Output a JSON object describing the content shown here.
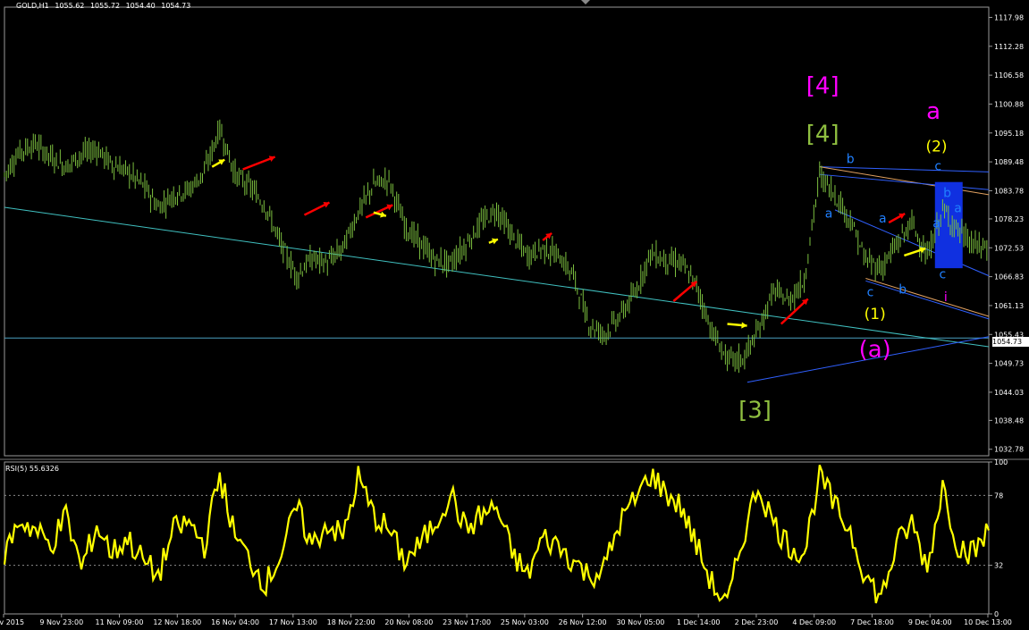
{
  "header": {
    "symbol": "GOLD,H1",
    "open": "1055.62",
    "high": "1055.72",
    "low": "1054.40",
    "close": "1054.73"
  },
  "current_price": "1054.73",
  "rsi": {
    "label": "RSI(5) 55.6326",
    "levels": [
      100,
      78,
      32,
      0
    ]
  },
  "colors": {
    "background": "#000000",
    "candles": "#7cbf3f",
    "rsi_line": "#ffff00",
    "trend_line": "#40c0c0",
    "channel": "#3060ff",
    "wave_magenta": "#ff00ff",
    "wave_green": "#8fbf40",
    "wave_yellow": "#ffff00",
    "wave_blue": "#2080ff",
    "arrow_red": "#ff0000",
    "arrow_yellow": "#ffff00"
  },
  "wave_labels": [
    {
      "text": "[4]",
      "color": "magenta",
      "time": 53.2,
      "price": 1103.0
    },
    {
      "text": "[4]",
      "color": "green",
      "time": 53.2,
      "price": 1093.5
    },
    {
      "text": "[3]",
      "color": "green",
      "time": 48.8,
      "price": 1039.0
    },
    {
      "text": "a",
      "color": "magenta",
      "time": 60.4,
      "price": 1098.0
    },
    {
      "text": "(2)",
      "color": "yellow",
      "time": 60.6,
      "price": 1091.5
    },
    {
      "text": "(1)",
      "color": "yellow",
      "time": 56.6,
      "price": 1058.5
    },
    {
      "text": "(a)",
      "color": "magenta",
      "time": 56.6,
      "price": 1051.0
    },
    {
      "text": "b",
      "color": "blue",
      "time": 55.0,
      "price": 1089.2
    },
    {
      "text": "c",
      "color": "blue",
      "time": 60.7,
      "price": 1087.8
    },
    {
      "text": "b",
      "color": "blue",
      "time": 61.3,
      "price": 1082.5
    },
    {
      "text": "a",
      "color": "blue",
      "time": 53.6,
      "price": 1078.5
    },
    {
      "text": "a",
      "color": "blue",
      "time": 57.1,
      "price": 1077.5
    },
    {
      "text": "a",
      "color": "blue",
      "time": 62.0,
      "price": 1079.5
    },
    {
      "text": "a",
      "color": "blue",
      "time": 60.6,
      "price": 1076.5
    },
    {
      "text": "c",
      "color": "blue",
      "time": 56.3,
      "price": 1063.0
    },
    {
      "text": "b",
      "color": "blue",
      "time": 58.4,
      "price": 1063.5
    },
    {
      "text": "c",
      "color": "blue",
      "time": 61.0,
      "price": 1066.5
    },
    {
      "text": "i",
      "color": "magenta",
      "time": 61.2,
      "price": 1062.0
    }
  ],
  "chart_data": [
    {
      "type": "candlestick",
      "title": "GOLD,H1 1055.62 1055.72 1054.40 1054.73",
      "x_axis_labels": [
        "6 Nov 2015",
        "9 Nov 23:00",
        "11 Nov 09:00",
        "12 Nov 18:00",
        "16 Nov 04:00",
        "17 Nov 13:00",
        "18 Nov 22:00",
        "20 Nov 08:00",
        "23 Nov 17:00",
        "25 Nov 03:00",
        "26 Nov 12:00",
        "30 Nov 05:00",
        "1 Dec 14:00",
        "2 Dec 23:00",
        "4 Dec 09:00",
        "7 Dec 18:00",
        "9 Dec 04:00",
        "10 Dec 13:00"
      ],
      "y_ticks": [
        1117.98,
        1112.28,
        1106.58,
        1100.88,
        1095.18,
        1089.48,
        1083.78,
        1078.23,
        1072.53,
        1066.83,
        1061.13,
        1055.43,
        1049.73,
        1044.03,
        1038.48,
        1032.78
      ],
      "ylim": [
        1031.5,
        1120.0
      ],
      "series": [
        {
          "name": "GOLD,H1",
          "x": [
            0,
            1,
            2,
            3,
            4,
            5,
            6,
            7,
            8,
            9,
            10,
            11,
            12,
            13,
            14,
            15,
            16,
            17,
            18,
            19,
            20,
            21,
            22,
            23,
            24,
            25,
            26,
            27,
            28,
            29,
            30,
            31,
            32,
            33,
            34,
            35,
            36,
            37,
            38,
            39,
            40,
            41,
            42,
            43,
            44,
            45,
            46,
            47,
            48,
            49,
            50,
            51,
            52,
            53,
            54,
            55,
            56,
            57,
            58,
            59,
            60,
            61,
            62,
            63,
            64
          ],
          "close": [
            1087.0,
            1091.5,
            1093.0,
            1090.5,
            1088.5,
            1091.0,
            1092.0,
            1089.0,
            1087.5,
            1085.0,
            1080.5,
            1083.0,
            1084.0,
            1087.5,
            1096.0,
            1087.0,
            1084.5,
            1080.5,
            1073.0,
            1067.0,
            1070.5,
            1069.5,
            1072.5,
            1079.5,
            1085.0,
            1086.0,
            1077.0,
            1073.5,
            1070.0,
            1069.5,
            1073.0,
            1077.5,
            1080.0,
            1075.0,
            1071.0,
            1072.5,
            1071.0,
            1067.0,
            1057.5,
            1055.5,
            1059.0,
            1063.5,
            1071.5,
            1070.0,
            1069.5,
            1065.0,
            1056.0,
            1050.5,
            1050.5,
            1056.0,
            1064.0,
            1062.0,
            1066.0,
            1087.0,
            1083.0,
            1078.0,
            1070.0,
            1068.5,
            1073.0,
            1077.5,
            1070.5,
            1080.0,
            1076.0,
            1073.0,
            1072.5
          ]
        }
      ],
      "annotations": [
        "[4]",
        "[4]",
        "[3]",
        "a",
        "(2)",
        "(1)",
        "(a)",
        "b",
        "c",
        "b",
        "a",
        "a",
        "a",
        "a",
        "c",
        "b",
        "c",
        "i"
      ]
    },
    {
      "type": "line",
      "title": "RSI(5) 55.6326",
      "y_ticks": [
        100,
        78,
        32,
        0
      ],
      "ylim": [
        0,
        100
      ],
      "series": [
        {
          "name": "RSI(5)",
          "x": [
            0,
            1,
            2,
            3,
            4,
            5,
            6,
            7,
            8,
            9,
            10,
            11,
            12,
            13,
            14,
            15,
            16,
            17,
            18,
            19,
            20,
            21,
            22,
            23,
            24,
            25,
            26,
            27,
            28,
            29,
            30,
            31,
            32,
            33,
            34,
            35,
            36,
            37,
            38,
            39,
            40,
            41,
            42,
            43,
            44,
            45,
            46,
            47,
            48,
            49,
            50,
            51,
            52,
            53,
            54,
            55,
            56,
            57,
            58,
            59,
            60,
            61,
            62,
            63,
            64
          ],
          "values": [
            40,
            62,
            55,
            45,
            65,
            30,
            58,
            40,
            50,
            35,
            25,
            55,
            60,
            45,
            92,
            50,
            35,
            20,
            40,
            70,
            45,
            60,
            50,
            90,
            65,
            55,
            35,
            45,
            60,
            80,
            55,
            65,
            70,
            40,
            25,
            50,
            45,
            35,
            25,
            30,
            60,
            75,
            92,
            80,
            70,
            45,
            20,
            5,
            50,
            85,
            60,
            45,
            40,
            92,
            70,
            55,
            25,
            10,
            45,
            60,
            30,
            85,
            45,
            40,
            55
          ]
        }
      ]
    }
  ]
}
